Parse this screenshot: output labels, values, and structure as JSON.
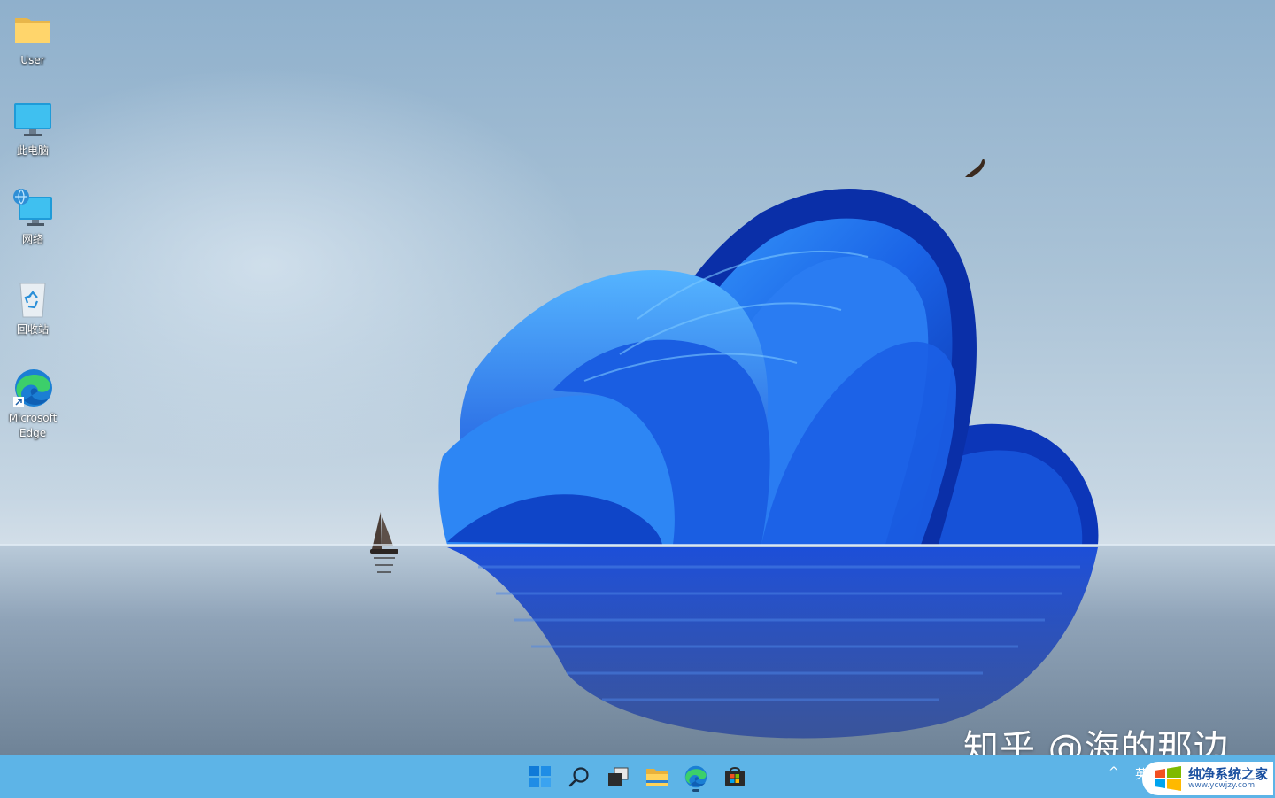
{
  "desktop": {
    "icons": [
      {
        "label": "User",
        "icon": "folder-icon"
      },
      {
        "label": "此电脑",
        "icon": "computer-icon"
      },
      {
        "label": "网络",
        "icon": "network-icon"
      },
      {
        "label": "回收站",
        "icon": "recycle-bin-icon"
      },
      {
        "label": "Microsoft\nEdge",
        "icon": "edge-icon"
      }
    ]
  },
  "watermark": {
    "text": "知乎 @海的那边"
  },
  "taskbar": {
    "background": "#5db4e7",
    "buttons": [
      {
        "icon": "windows-start-icon"
      },
      {
        "icon": "search-icon"
      },
      {
        "icon": "task-view-icon"
      },
      {
        "icon": "file-explorer-icon"
      },
      {
        "icon": "edge-icon"
      },
      {
        "icon": "microsoft-store-icon"
      }
    ],
    "tray": {
      "chevron": "^",
      "lang": "英",
      "logo_main": "纯净系统之家",
      "logo_url": "www.ycwjzy.com"
    }
  }
}
